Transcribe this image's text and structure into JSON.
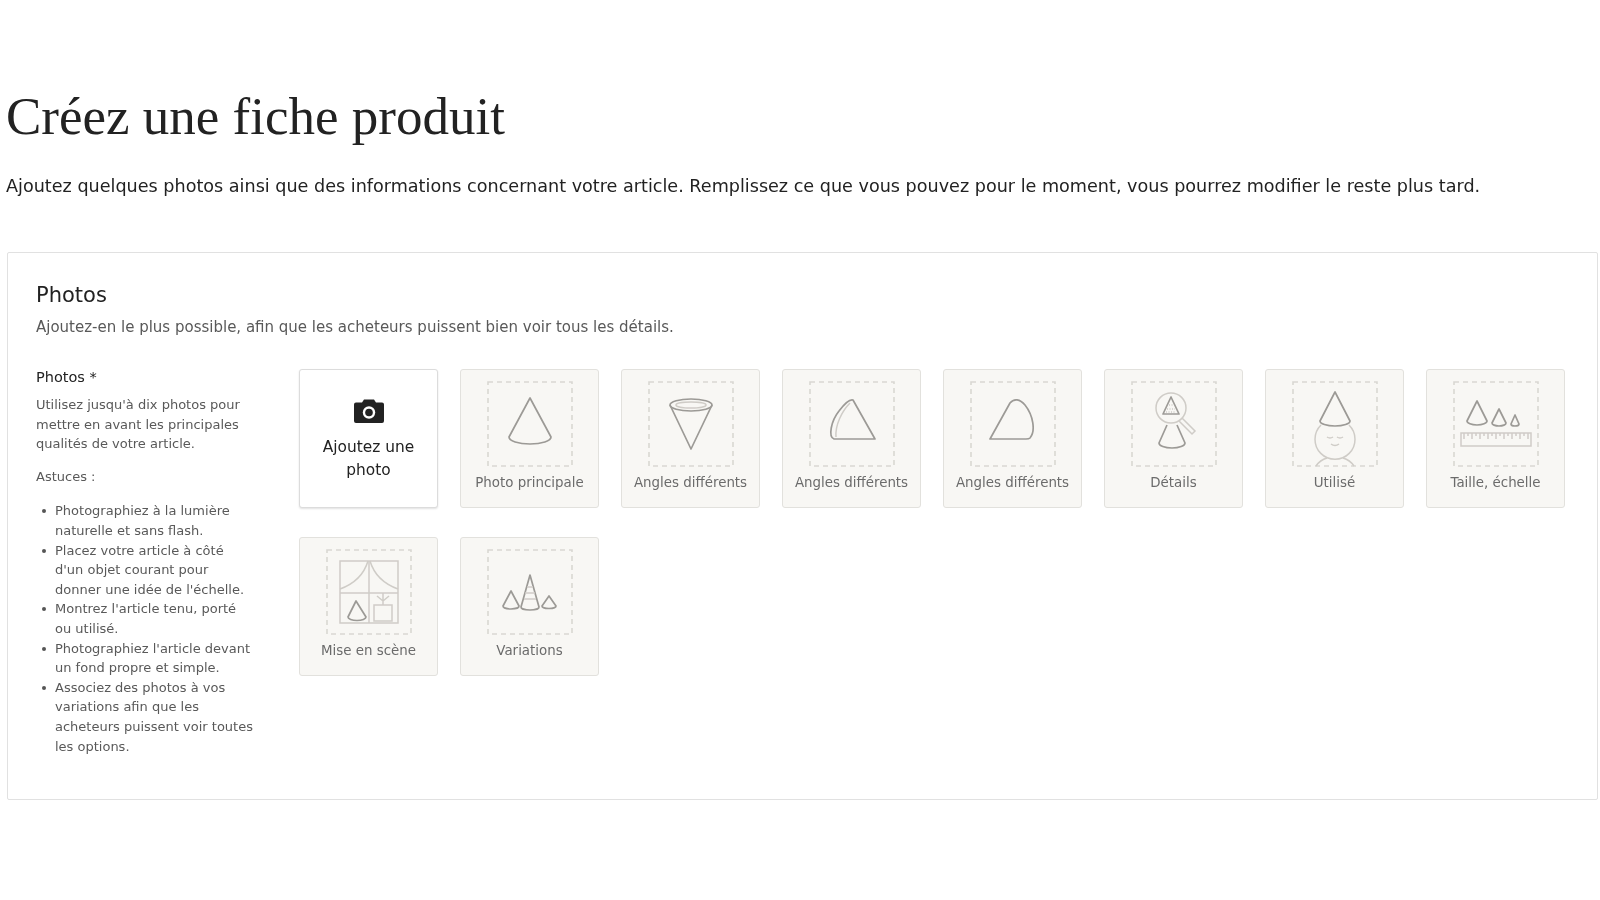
{
  "page": {
    "title": "Créez une fiche produit",
    "subtitle": "Ajoutez quelques photos ainsi que des informations concernant votre article. Remplissez ce que vous pouvez pour le moment, vous pourrez modifier le reste plus tard."
  },
  "photos_section": {
    "title": "Photos",
    "description": "Ajoutez-en le plus possible, afin que les acheteurs puissent bien voir tous les détails.",
    "field": {
      "label": "Photos *",
      "help": "Utilisez jusqu'à dix photos pour mettre en avant les principales qualités de votre article.",
      "tips_label": "Astuces :",
      "tips": [
        "Photographiez à la lumière naturelle et sans flash.",
        "Placez votre article à côté d'un objet courant pour donner une idée de l'échelle.",
        "Montrez l'article tenu, porté ou utilisé.",
        "Photographiez l'article devant un fond propre et simple.",
        "Associez des photos à vos variations afin que les acheteurs puissent voir toutes les options."
      ]
    },
    "add_button": {
      "label": "Ajoutez une photo"
    },
    "slots": [
      {
        "label": "Photo principale",
        "kind": "upright"
      },
      {
        "label": "Angles différents",
        "kind": "inverted"
      },
      {
        "label": "Angles différents",
        "kind": "tilted"
      },
      {
        "label": "Angles différents",
        "kind": "profile"
      },
      {
        "label": "Détails",
        "kind": "details"
      },
      {
        "label": "Utilisé",
        "kind": "worn"
      },
      {
        "label": "Taille, échelle",
        "kind": "scale"
      },
      {
        "label": "Mise en scène",
        "kind": "scene"
      },
      {
        "label": "Variations",
        "kind": "variants"
      }
    ]
  }
}
